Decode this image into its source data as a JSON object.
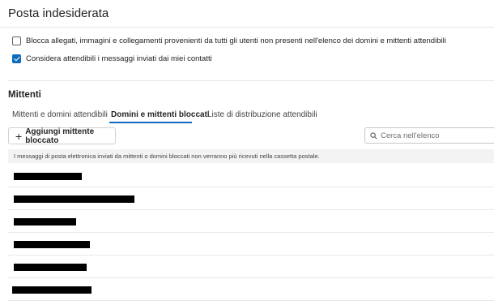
{
  "page": {
    "title": "Posta indesiderata"
  },
  "options": {
    "block_attachments": {
      "label": "Blocca allegati, immagini e collegamenti provenienti da tutti gli utenti non presenti nell'elenco dei domini e mittenti attendibili",
      "checked": false
    },
    "trust_contacts": {
      "label": "Considera attendibili i messaggi inviati dai miei contatti",
      "checked": true
    }
  },
  "senders": {
    "heading": "Mittenti",
    "tabs": [
      {
        "label": "Mittenti e domini attendibili",
        "active": false
      },
      {
        "label": "Domini e mittenti bloccati",
        "active": true
      },
      {
        "label": "Liste di distribuzione attendibili",
        "active": false
      }
    ],
    "add_button_label": "Aggiungi mittente bloccato",
    "search_placeholder": "Cerca nell'elenco",
    "info_text": "I messaggi di posta elettronica inviati da mittenti o domini bloccati non verranno più ricevuti nella cassetta postale.",
    "accent_color": "#0f6cbd"
  }
}
